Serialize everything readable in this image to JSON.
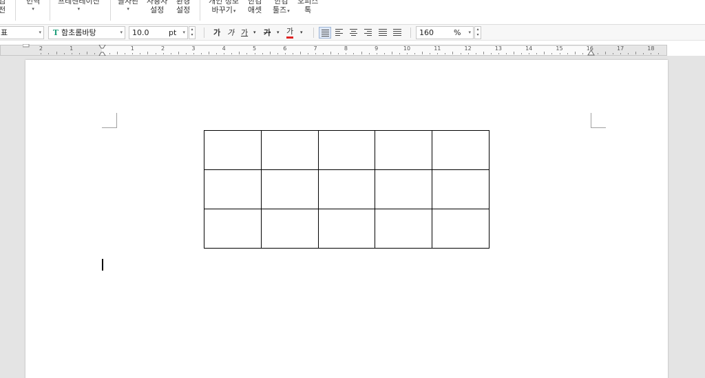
{
  "ribbon": {
    "item_left_cut": {
      "line1": "컴",
      "line2": "전"
    },
    "translate": {
      "label": "번역"
    },
    "presentation": {
      "label": "프레젠테이션"
    },
    "typing_board": {
      "label": "글자판"
    },
    "user_settings": {
      "line1": "사용자",
      "line2": "설정"
    },
    "env_settings": {
      "line1": "환경",
      "line2": "설정"
    },
    "privacy_change": {
      "line1": "개인 정보",
      "line2": "바꾸기"
    },
    "hancom_asset": {
      "line1": "한컴",
      "line2": "애셋"
    },
    "hancom_tools": {
      "line1": "한컴",
      "line2": "툴즈"
    },
    "office_tok": {
      "line1": "오피스",
      "line2": "톡"
    }
  },
  "format_bar": {
    "style_value": "표",
    "font_value": "함초롬바탕",
    "font_icon": "T",
    "size_value": "10.0",
    "size_unit": "pt",
    "bold_label": "가",
    "italic_label": "가",
    "underline_label": "가",
    "strike_label": "가",
    "color_label": "가",
    "zoom_value": "160",
    "zoom_unit": "%"
  },
  "ruler": {
    "numbers": [
      "2",
      "1",
      "1",
      "2",
      "3",
      "4",
      "5",
      "6",
      "7",
      "8",
      "9",
      "10",
      "11",
      "12",
      "13",
      "14",
      "15",
      "16",
      "17",
      "18"
    ]
  },
  "document": {
    "table": {
      "rows": 3,
      "cols": 5
    }
  },
  "colors": {
    "text_color_underline": "#e02020",
    "font_icon": "#1e9e7a",
    "active_align_bg": "#dfe8f6"
  }
}
